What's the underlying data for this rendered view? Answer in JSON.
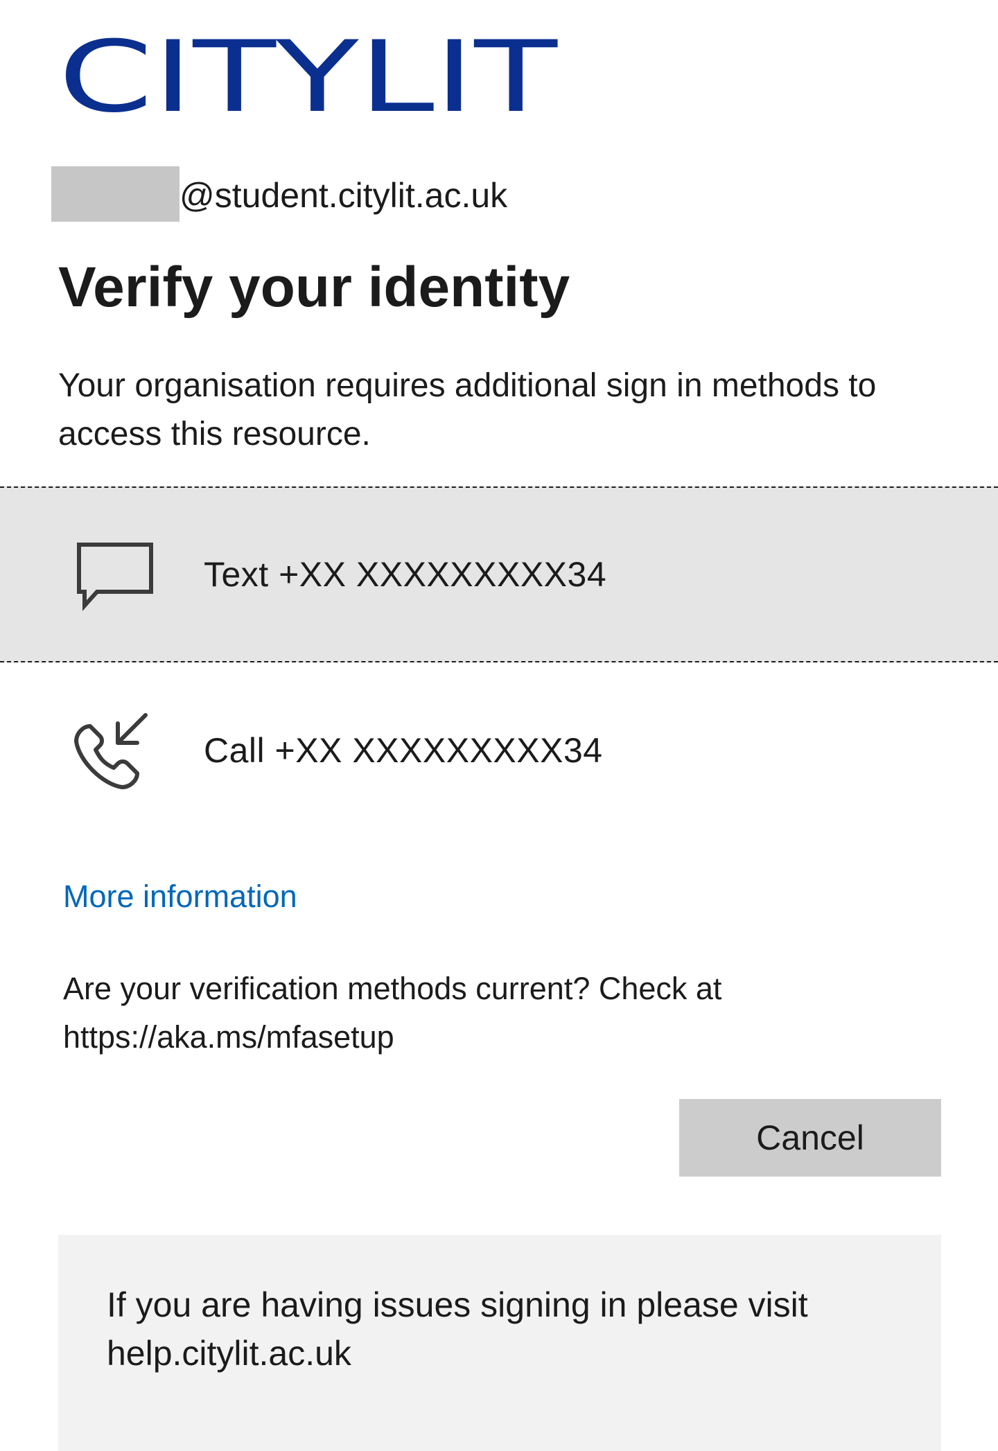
{
  "brand": {
    "logo_text": "CITYLIT",
    "logo_color": "#0a2f8f"
  },
  "account": {
    "domain": "@student.citylit.ac.uk"
  },
  "page": {
    "title": "Verify your identity",
    "description": "Your organisation requires additional sign in methods to access this resource."
  },
  "methods": [
    {
      "icon": "chat-bubble-icon",
      "label": "Text +XX XXXXXXXXX34",
      "selected": true
    },
    {
      "icon": "incoming-call-icon",
      "label": "Call +XX XXXXXXXXX34",
      "selected": false
    }
  ],
  "links": {
    "more_info": "More information"
  },
  "check_methods": {
    "text": "Are your verification methods current? Check at https://aka.ms/mfasetup"
  },
  "actions": {
    "cancel_label": "Cancel"
  },
  "help": {
    "text": "If you are having issues signing in please visit help.citylit.ac.uk"
  },
  "colors": {
    "link": "#0067b8",
    "selected_bg": "#e5e5e5",
    "button_bg": "#cccccc",
    "help_bg": "#f2f2f2",
    "redaction": "#c6c6c6"
  }
}
